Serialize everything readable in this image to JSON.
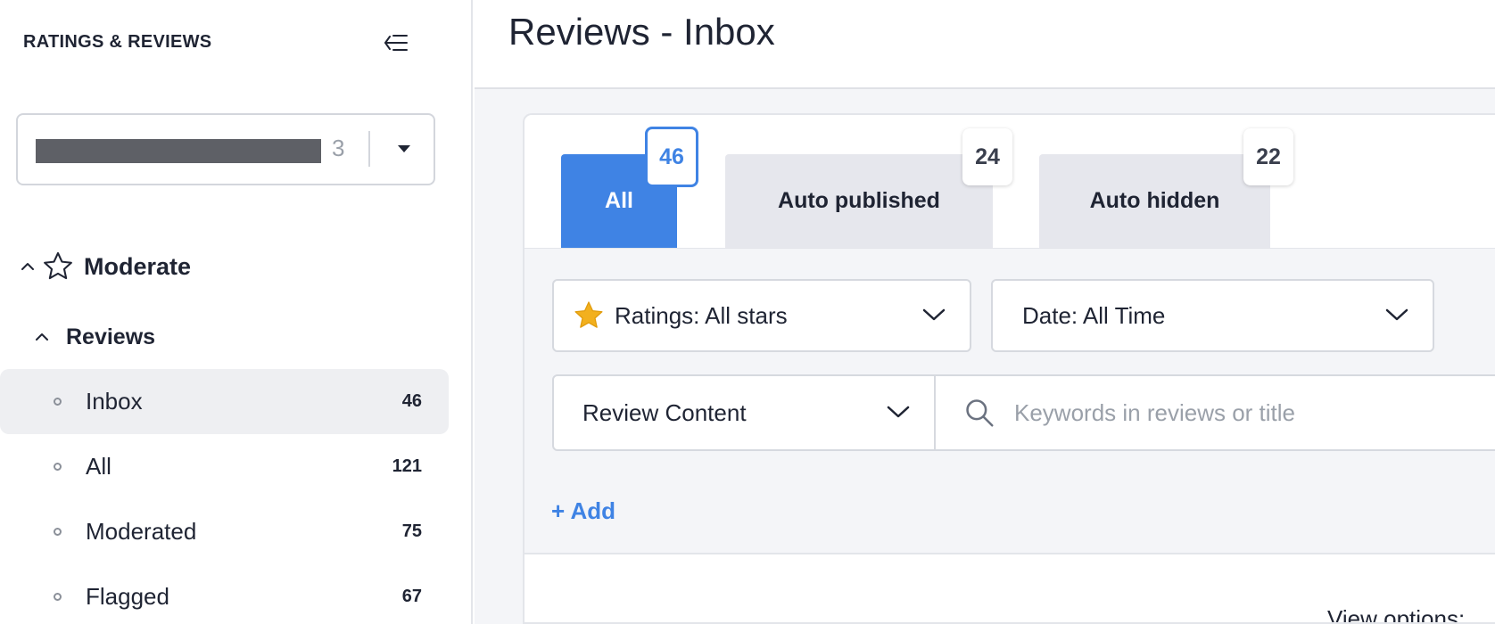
{
  "sidebar": {
    "header": "RATINGS & REVIEWS",
    "store_select": {
      "count": "3"
    },
    "sections": [
      {
        "label": "Moderate",
        "subsections": [
          {
            "label": "Reviews",
            "items": [
              {
                "label": "Inbox",
                "count": "46",
                "active": true
              },
              {
                "label": "All",
                "count": "121"
              },
              {
                "label": "Moderated",
                "count": "75"
              },
              {
                "label": "Flagged",
                "count": "67"
              }
            ]
          }
        ]
      }
    ]
  },
  "main": {
    "title": "Reviews - Inbox",
    "tabs": [
      {
        "label": "All",
        "count": "46",
        "active": true
      },
      {
        "label": "Auto published",
        "count": "24"
      },
      {
        "label": "Auto hidden",
        "count": "22"
      }
    ],
    "filters": {
      "ratings": "Ratings: All stars",
      "date": "Date: All Time",
      "field": "Review Content",
      "search_placeholder": "Keywords in reviews or title",
      "add_label": "+ Add"
    },
    "view_options_label": "View options:"
  },
  "colors": {
    "accent": "#3f83e4",
    "star": "#f2b01e",
    "sidebar_active": "#eeeff2"
  }
}
